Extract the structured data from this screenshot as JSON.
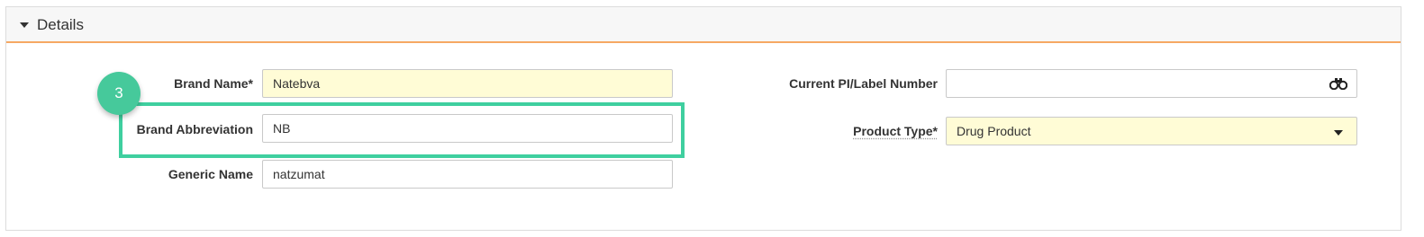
{
  "panel": {
    "title": "Details"
  },
  "form": {
    "brand_name": {
      "label": "Brand Name*",
      "value": "Natebva"
    },
    "brand_abbreviation": {
      "label": "Brand Abbreviation",
      "value": "NB"
    },
    "generic_name": {
      "label": "Generic Name",
      "value": "natzumat"
    },
    "current_pi_label_number": {
      "label": "Current PI/Label Number",
      "value": ""
    },
    "product_type": {
      "label": "Product Type*",
      "value": "Drug Product"
    }
  },
  "callout": {
    "step_number": "3",
    "color": "#46c99b"
  },
  "colors": {
    "required_field_bg": "#fffcd6",
    "header_accent": "#f6a863"
  }
}
